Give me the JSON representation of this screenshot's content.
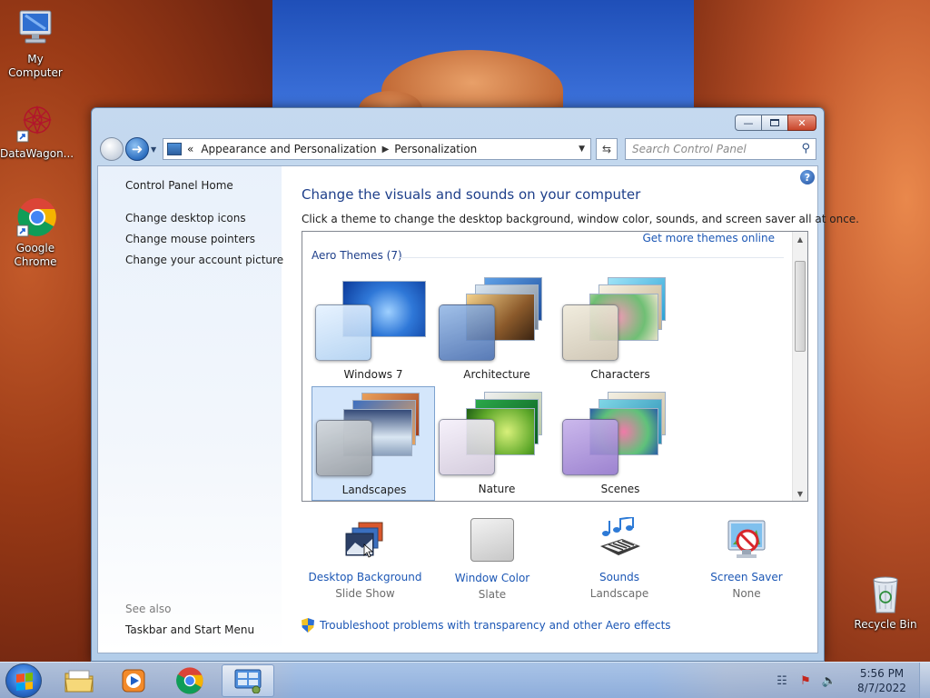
{
  "desktop": {
    "icons": [
      {
        "label": "My Computer"
      },
      {
        "label": "DataWagon..."
      },
      {
        "label": "Google Chrome"
      },
      {
        "label": "Recycle Bin"
      }
    ]
  },
  "window": {
    "breadcrumb": [
      "Appearance and Personalization",
      "Personalization"
    ],
    "breadcrumb_chevron": "«",
    "search_placeholder": "Search Control Panel",
    "help_label": "?"
  },
  "sidebar": {
    "home": "Control Panel Home",
    "links": [
      "Change desktop icons",
      "Change mouse pointers",
      "Change your account picture"
    ],
    "see_also_label": "See also",
    "see_also_links": [
      "Taskbar and Start Menu"
    ]
  },
  "main": {
    "heading": "Change the visuals and sounds on your computer",
    "subheading": "Click a theme to change the desktop background, window color, sounds, and screen saver all at once.",
    "get_more_themes": "Get more themes online",
    "group_label": "Aero Themes (7)",
    "themes": [
      {
        "name": "Windows 7",
        "selected": false
      },
      {
        "name": "Architecture",
        "selected": false
      },
      {
        "name": "Characters",
        "selected": false
      },
      {
        "name": "Landscapes",
        "selected": true
      },
      {
        "name": "Nature",
        "selected": false
      },
      {
        "name": "Scenes",
        "selected": false
      }
    ],
    "bottom_items": [
      {
        "title": "Desktop Background",
        "sub": "Slide Show"
      },
      {
        "title": "Window Color",
        "sub": "Slate"
      },
      {
        "title": "Sounds",
        "sub": "Landscape"
      },
      {
        "title": "Screen Saver",
        "sub": "None"
      }
    ],
    "troubleshoot": "Troubleshoot problems with transparency and other Aero effects"
  },
  "taskbar": {
    "time": "5:56 PM",
    "date": "8/7/2022",
    "pinned": [
      "windows-explorer",
      "windows-media-player",
      "google-chrome",
      "control-panel"
    ],
    "active": "control-panel"
  },
  "colors": {
    "link": "#1c57b5",
    "heading": "#1e3f8a",
    "selection": "#d4e6fb"
  }
}
